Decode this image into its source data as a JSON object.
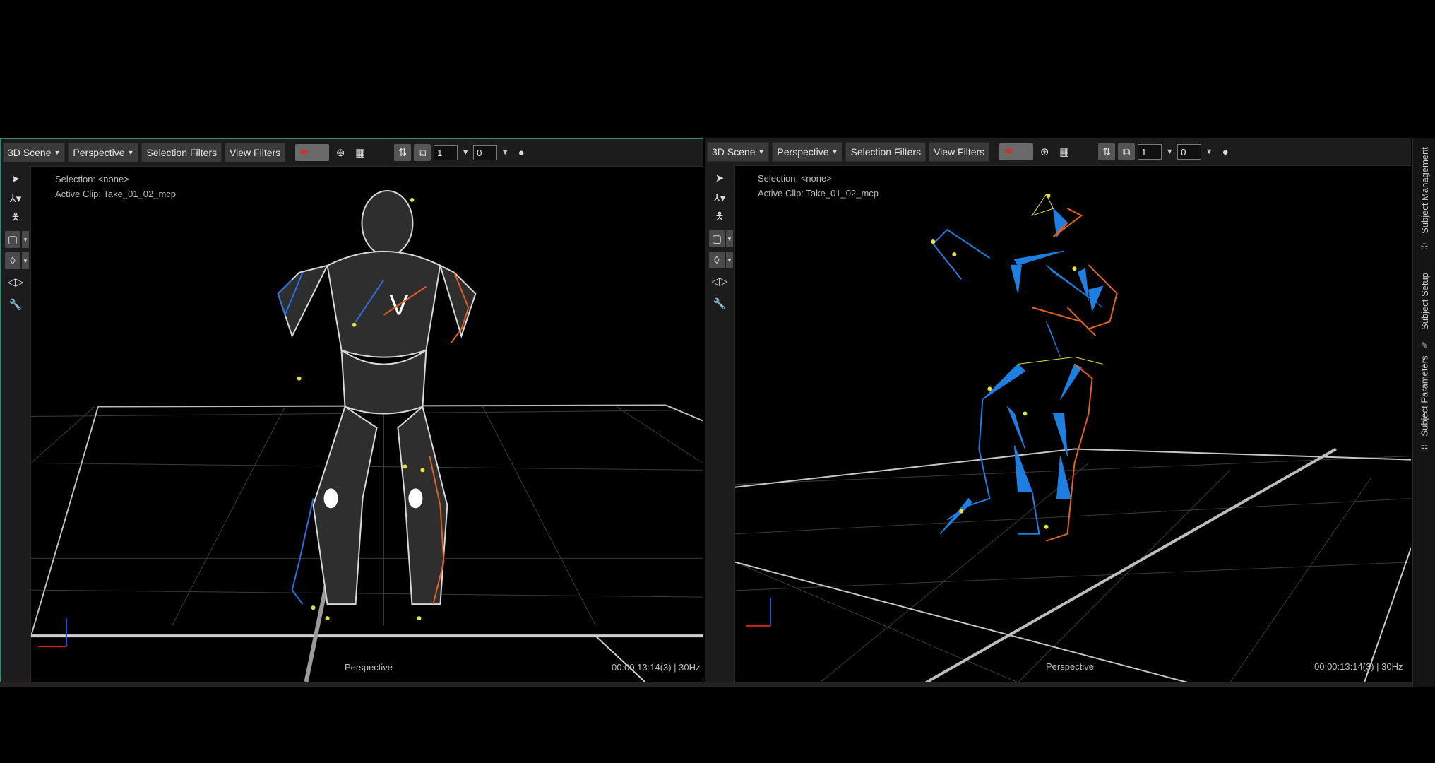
{
  "left_viewport": {
    "toolbar": {
      "scene_label": "3D Scene",
      "view_label": "Perspective",
      "selection_filters": "Selection Filters",
      "view_filters": "View Filters",
      "field_a": "1",
      "field_b": "0"
    },
    "selection": "Selection: <none>",
    "active_clip": "Active Clip: Take_01_02_mcp",
    "camera_label": "Perspective",
    "timecode": "00:00:13:14(3) | 30Hz"
  },
  "right_viewport": {
    "toolbar": {
      "scene_label": "3D Scene",
      "view_label": "Perspective",
      "selection_filters": "Selection Filters",
      "view_filters": "View Filters",
      "field_a": "1",
      "field_b": "0"
    },
    "selection": "Selection: <none>",
    "active_clip": "Active Clip: Take_01_02_mcp",
    "camera_label": "Perspective",
    "timecode": "00:00:13:14(3) | 30Hz"
  },
  "right_tabs": [
    "Subject Management",
    "Subject Setup",
    "Subject Parameters"
  ],
  "icons": {
    "select": "arrow-cursor-icon",
    "transform": "axis-gizmo-icon",
    "figure": "figure-icon",
    "camera_mode": "box-camera-icon",
    "marker": "marker-icon",
    "playback": "step-icon",
    "tools": "wrench-icon"
  },
  "colors": {
    "accent_border": "#2b8f75",
    "bone_blue": "#1f7fe0",
    "bone_orange": "#e06020",
    "marker_yellow": "#e8e040"
  }
}
